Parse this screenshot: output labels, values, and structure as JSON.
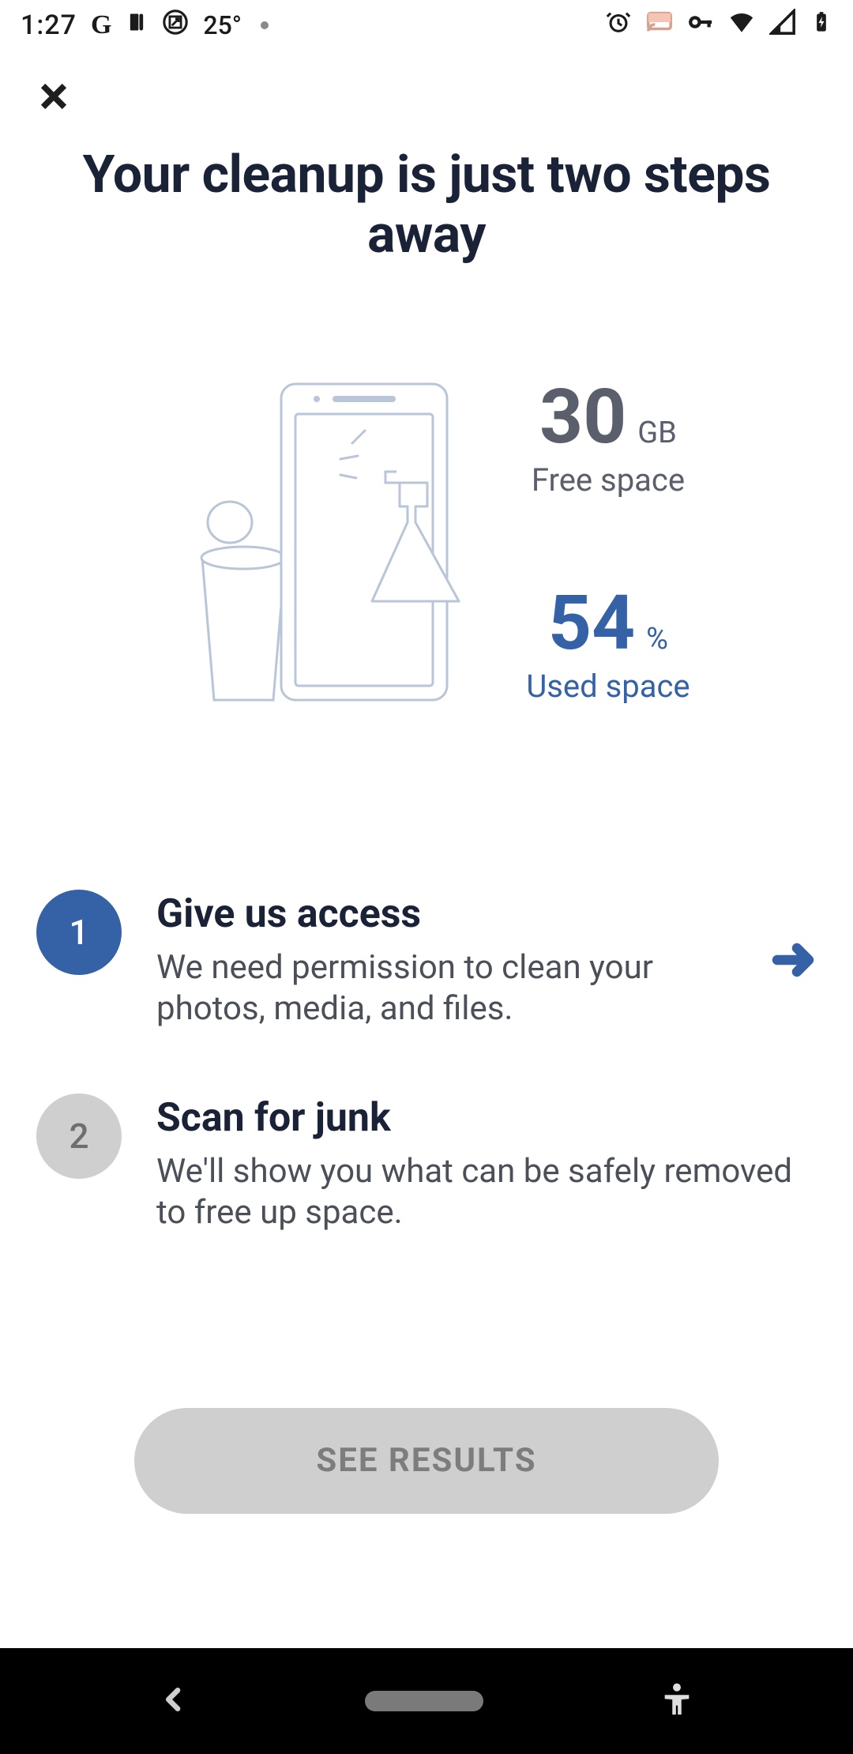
{
  "status": {
    "time": "1:27",
    "temperature": "25°"
  },
  "header": {
    "title": "Your cleanup is just two steps away"
  },
  "storage": {
    "free_value": "30",
    "free_unit": "GB",
    "free_label": "Free space",
    "used_value": "54",
    "used_unit": "%",
    "used_label": "Used space"
  },
  "steps": [
    {
      "number": "1",
      "title": "Give us access",
      "description": "We need permission to clean your photos, media, and files."
    },
    {
      "number": "2",
      "title": "Scan for junk",
      "description": "We'll show you what can be safely removed to free up space."
    }
  ],
  "cta": {
    "label": "SEE RESULTS"
  }
}
